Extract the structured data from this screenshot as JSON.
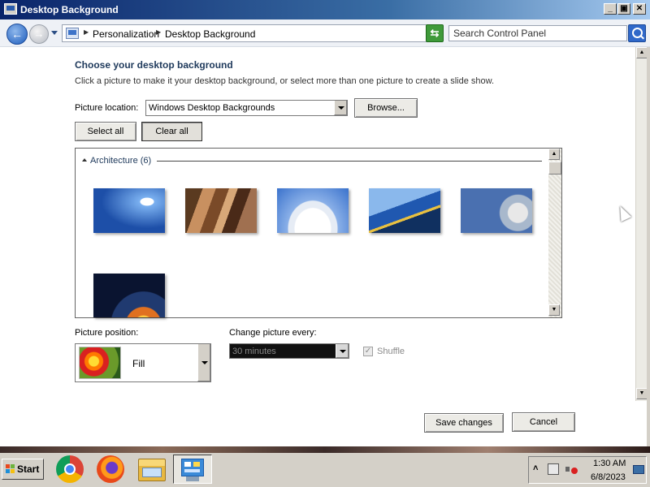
{
  "window": {
    "title": "Desktop Background",
    "minimize": "_",
    "restore": "▣",
    "close": "✕"
  },
  "address": {
    "crumbs": [
      "Personalization",
      "Desktop Background"
    ],
    "search_placeholder": "Search Control Panel"
  },
  "content": {
    "heading": "Choose your desktop background",
    "description": "Click a picture to make it your desktop background, or select more than one picture to create a slide show.",
    "picture_location_label": "Picture location:",
    "picture_location_value": "Windows Desktop Backgrounds",
    "browse_button": "Browse...",
    "select_all_button": "Select all",
    "clear_all_button": "Clear all",
    "group": {
      "label": "Architecture (6)",
      "thumbnails": [
        "thumb-1",
        "thumb-2",
        "thumb-3",
        "thumb-4",
        "thumb-5",
        "thumb-6"
      ]
    },
    "picture_position_label": "Picture position:",
    "picture_position_value": "Fill",
    "change_picture_label": "Change picture every:",
    "change_picture_value": "30 minutes",
    "shuffle_label": "Shuffle",
    "shuffle_checked": true,
    "save_button": "Save changes",
    "cancel_button": "Cancel"
  },
  "taskbar": {
    "start_label": "Start",
    "apps": [
      "chrome-icon",
      "firefox-icon",
      "file-explorer-icon",
      "control-panel-icon"
    ],
    "clock_time": "1:30 AM",
    "clock_date": "6/8/2023"
  }
}
